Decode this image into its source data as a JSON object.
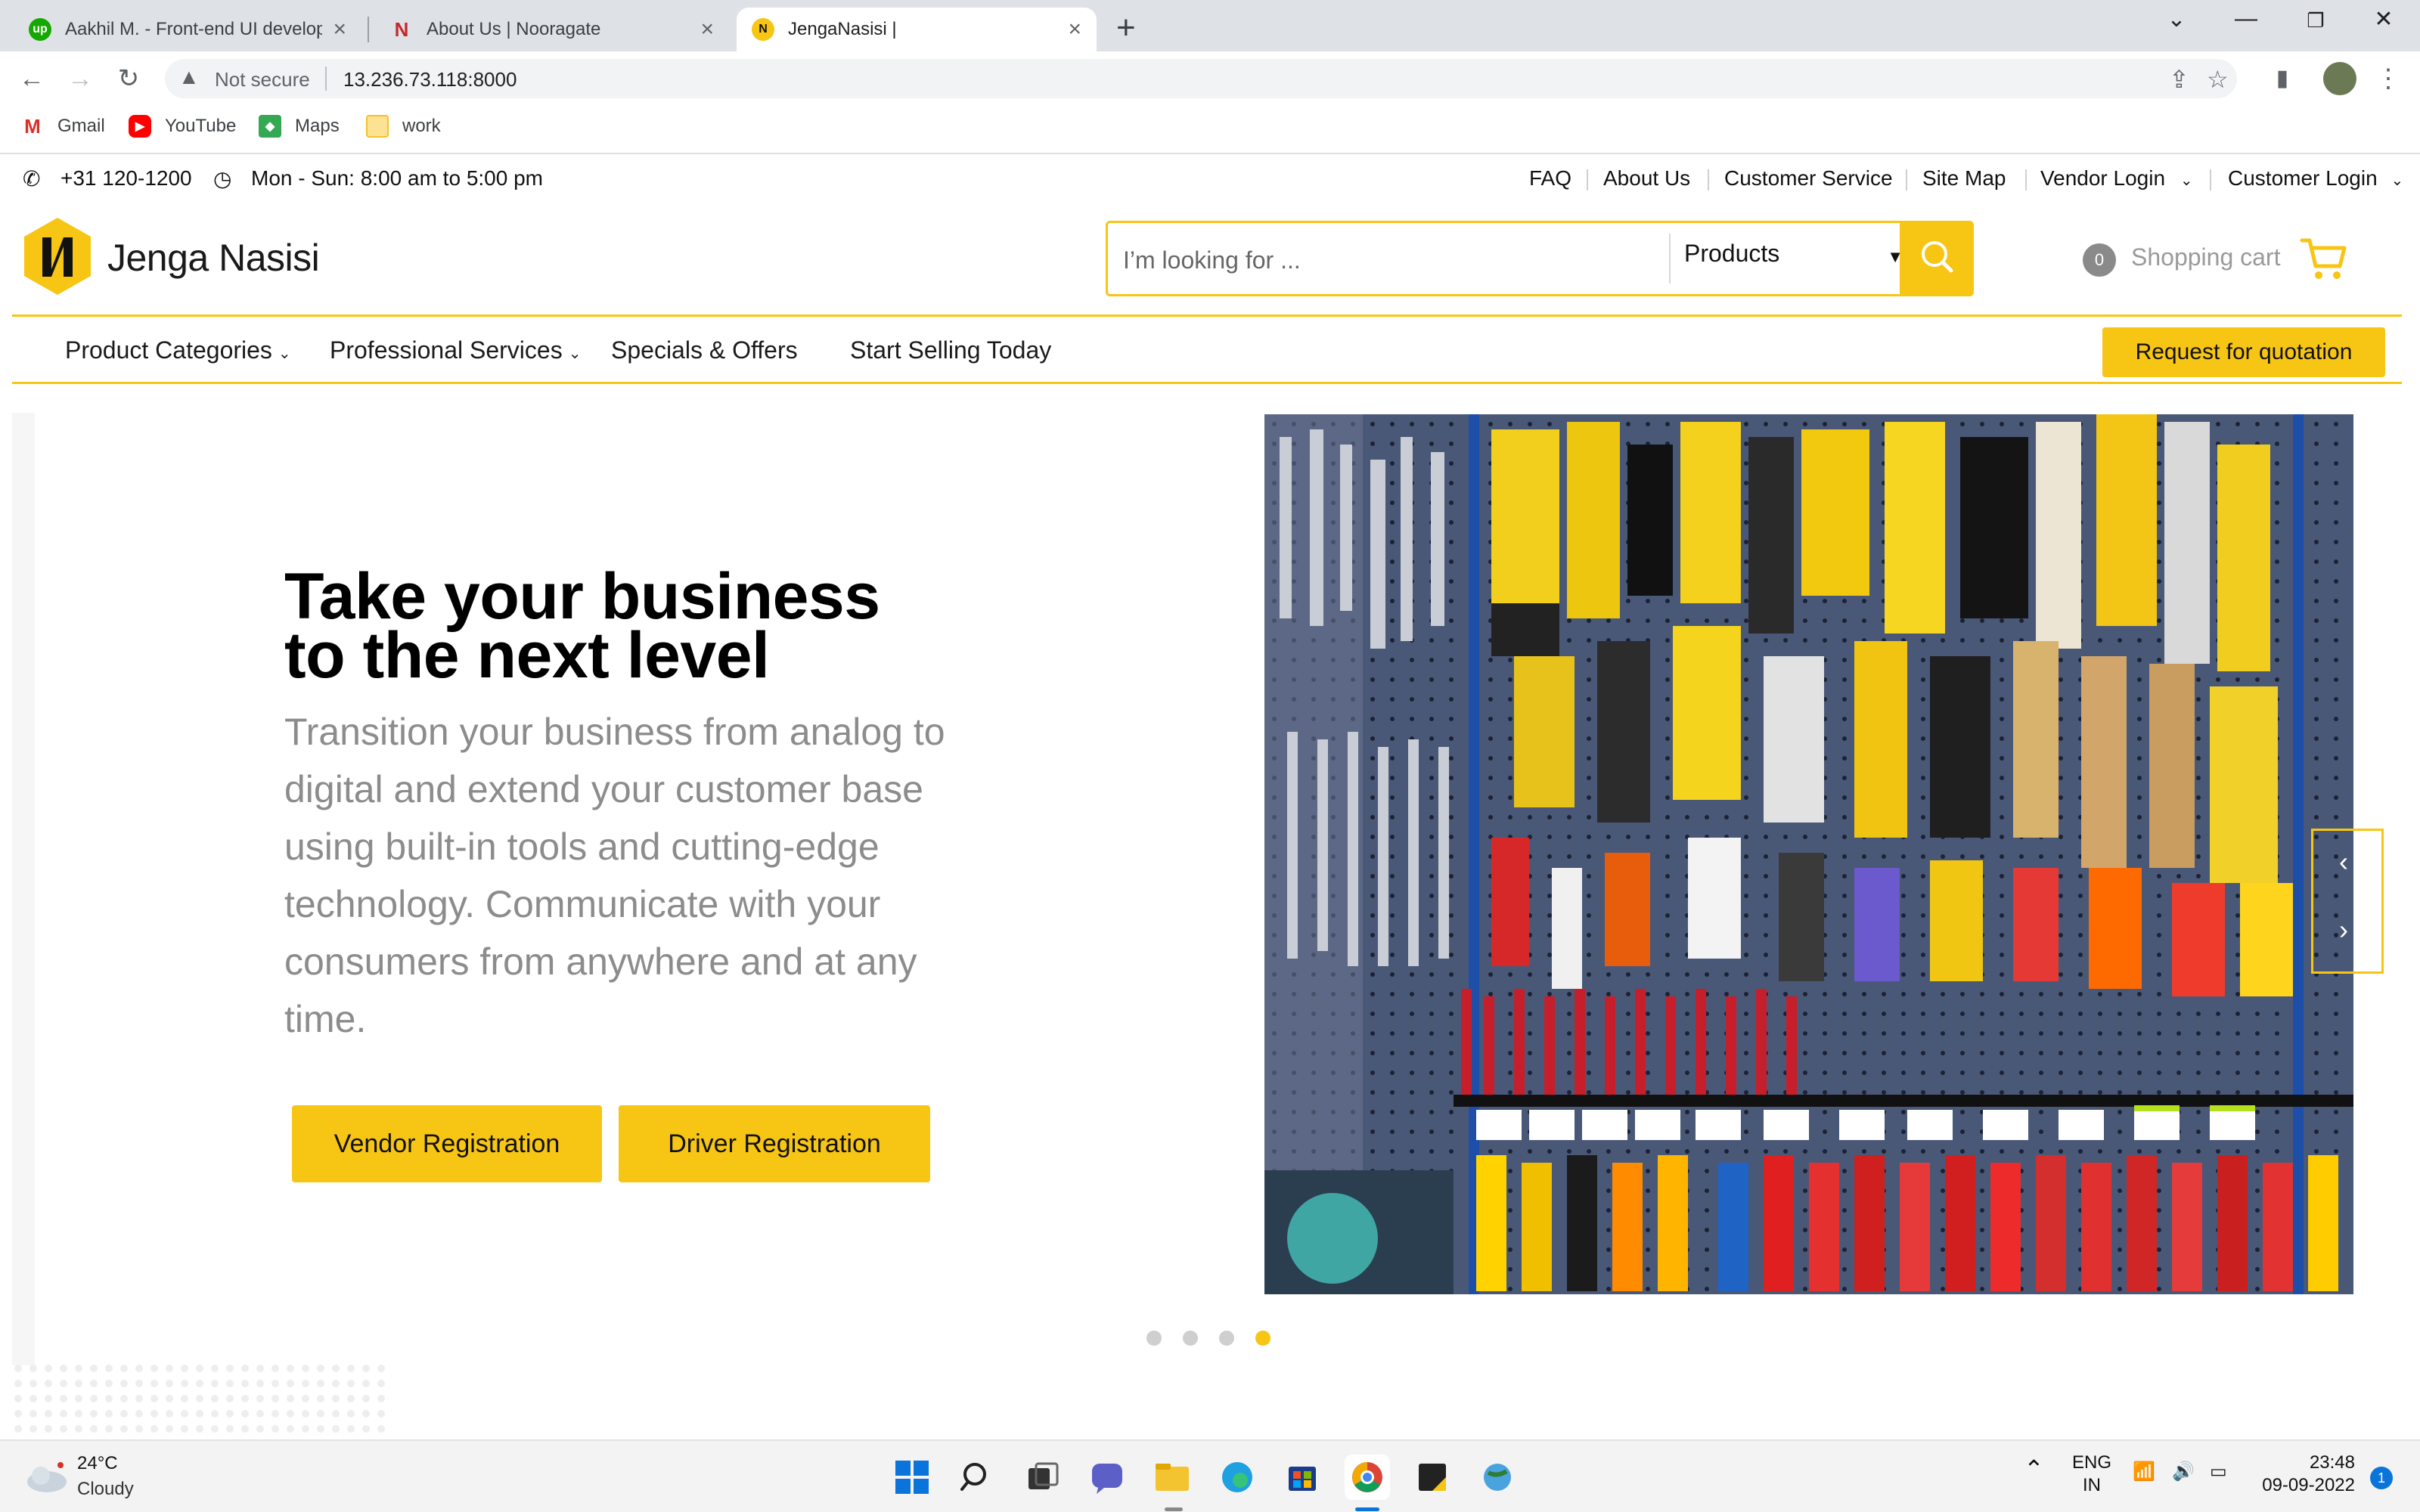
{
  "browser": {
    "tabs": [
      {
        "title": "Aakhil M. - Front-end UI develop",
        "icon": "upwork-icon",
        "active": false
      },
      {
        "title": "About Us | Nooragate",
        "icon": "nooragate-icon",
        "active": false
      },
      {
        "title": "JengaNasisi |",
        "icon": "jenganasisi-icon",
        "active": true
      }
    ],
    "address": {
      "security_label": "Not secure",
      "url": "13.236.73.118:8000"
    },
    "bookmarks": [
      {
        "label": "Gmail",
        "icon": "gmail-icon"
      },
      {
        "label": "YouTube",
        "icon": "youtube-icon"
      },
      {
        "label": "Maps",
        "icon": "maps-icon"
      },
      {
        "label": "work",
        "icon": "folder-icon"
      }
    ]
  },
  "site": {
    "topbar": {
      "phone": "+31 120-1200",
      "hours": "Mon - Sun: 8:00 am to 5:00 pm",
      "links": [
        "FAQ",
        "About Us",
        "Customer Service",
        "Site Map",
        "Vendor Login",
        "Customer Login"
      ]
    },
    "logo_text": "Jenga Nasisi",
    "search": {
      "placeholder": "I’m looking for ...",
      "category": "Products"
    },
    "cart": {
      "count": "0",
      "label": "Shopping cart"
    },
    "nav": {
      "items": [
        "Product Categories",
        "Professional Services",
        "Specials & Offers",
        "Start Selling Today"
      ],
      "rfq_label": "Request for quotation"
    },
    "hero": {
      "heading_line1": "Take your business",
      "heading_line2": "to the next level",
      "body": "Transition your business from analog to digital and extend your customer base using built-in tools and cutting-edge technology. Communicate with your consumers from anywhere and at any time.",
      "button_vendor": "Vendor Registration",
      "button_driver": "Driver Registration",
      "slide_count": 4,
      "active_slide": 4
    },
    "colors": {
      "accent": "#f7c514",
      "text": "#111111",
      "muted": "#8c8c8c"
    }
  },
  "taskbar": {
    "weather": {
      "temp": "24°C",
      "desc": "Cloudy"
    },
    "lang_line1": "ENG",
    "lang_line2": "IN",
    "time": "23:48",
    "date": "09-09-2022",
    "notifications": "1"
  }
}
